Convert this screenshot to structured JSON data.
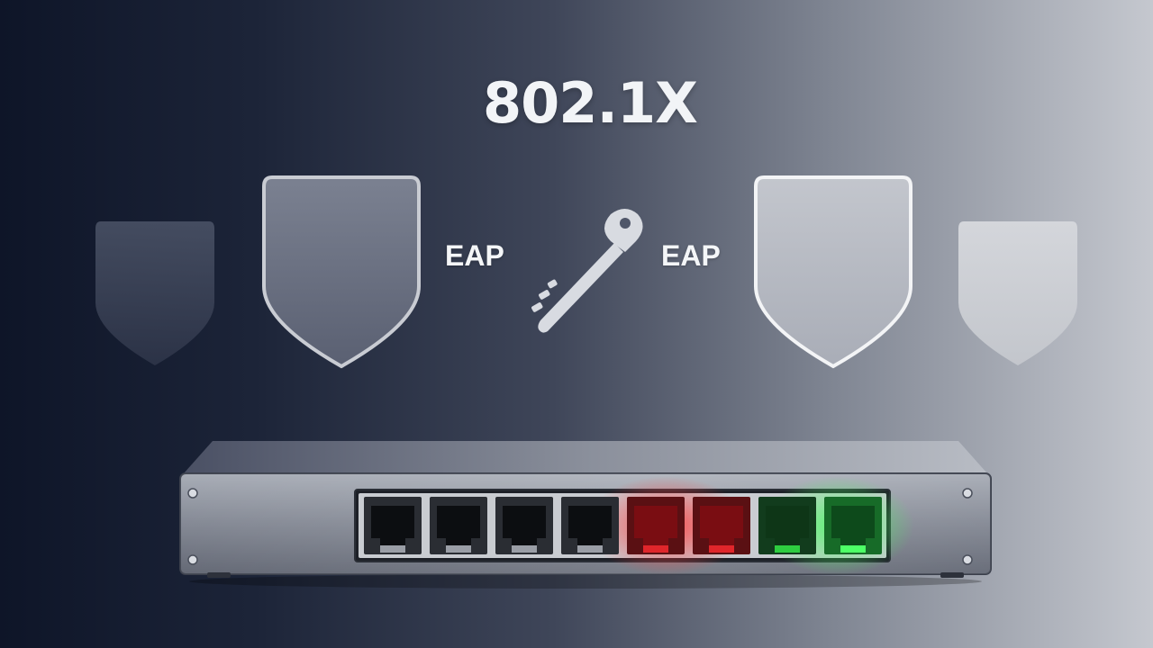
{
  "title": "802.1X",
  "labels": {
    "left": "EAP",
    "right": "EAP"
  },
  "icons": {
    "shields": [
      "shield-icon",
      "shield-icon",
      "shield-icon",
      "shield-icon"
    ],
    "key": "key-icon",
    "device": "network-switch"
  },
  "switch": {
    "port_count": 8,
    "port_status": [
      "off",
      "off",
      "off",
      "off",
      "red",
      "red",
      "green",
      "green"
    ]
  },
  "colors": {
    "port_red": "#e0262b",
    "port_green": "#2ecc40"
  }
}
